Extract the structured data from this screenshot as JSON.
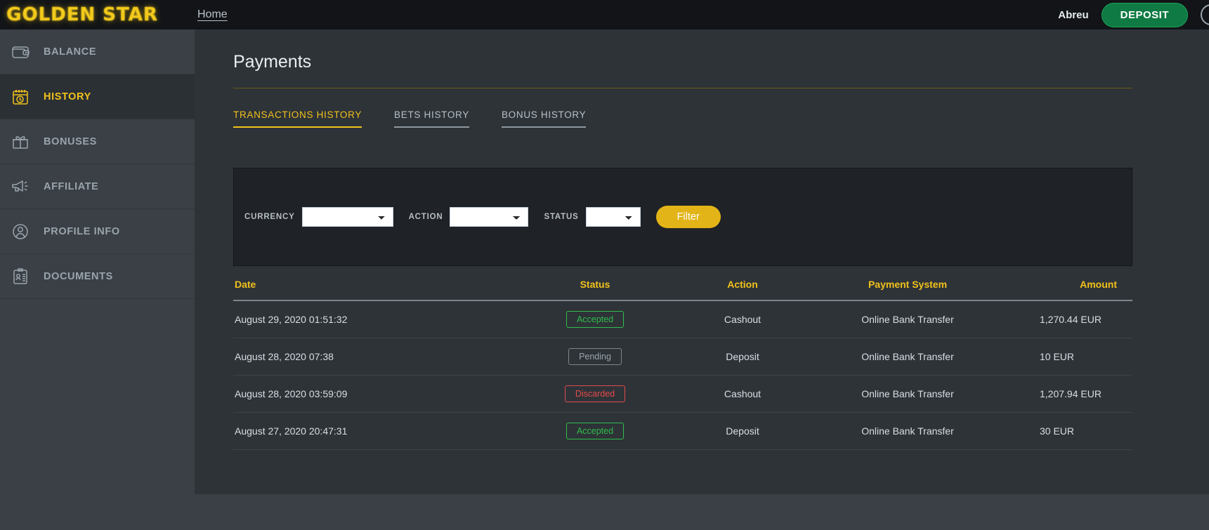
{
  "header": {
    "logo_text": "GOLDEN STAR",
    "nav": [
      {
        "label": "Home"
      }
    ],
    "username": "Abreu",
    "deposit_label": "DEPOSIT",
    "avatar_icon": "user-avatar-icon",
    "accent_yellow": "#f2c21b",
    "deposit_green": "#0f7a43"
  },
  "sidebar": {
    "items": [
      {
        "label": "BALANCE",
        "icon": "wallet-icon",
        "active": false
      },
      {
        "label": "HISTORY",
        "icon": "calendar-clock-icon",
        "active": true
      },
      {
        "label": "BONUSES",
        "icon": "gift-icon",
        "active": false
      },
      {
        "label": "AFFILIATE",
        "icon": "megaphone-icon",
        "active": false
      },
      {
        "label": "PROFILE INFO",
        "icon": "person-icon",
        "active": false
      },
      {
        "label": "DOCUMENTS",
        "icon": "id-card-icon",
        "active": false
      }
    ]
  },
  "main": {
    "page_title": "Payments",
    "tabs": [
      {
        "label": "TRANSACTIONS HISTORY",
        "active": true
      },
      {
        "label": "BETS HISTORY",
        "active": false
      },
      {
        "label": "BONUS HISTORY",
        "active": false
      }
    ],
    "filter": {
      "currency_label": "CURRENCY",
      "currency_value": "",
      "action_label": "ACTION",
      "action_value": "",
      "status_label": "STATUS",
      "status_value": "",
      "filter_button": "Filter",
      "dropdown_icon": "chevron-down-icon"
    },
    "table": {
      "columns": [
        {
          "key": "date",
          "label": "Date"
        },
        {
          "key": "status",
          "label": "Status"
        },
        {
          "key": "action",
          "label": "Action"
        },
        {
          "key": "system",
          "label": "Payment System"
        },
        {
          "key": "amount",
          "label": "Amount"
        }
      ],
      "rows": [
        {
          "date": "August 29, 2020 01:51:32",
          "status": "Accepted",
          "status_kind": "accepted",
          "action": "Cashout",
          "system": "Online Bank Transfer",
          "amount": "1,270.44 EUR"
        },
        {
          "date": "August 28, 2020 07:38",
          "status": "Pending",
          "status_kind": "pending",
          "action": "Deposit",
          "system": "Online Bank Transfer",
          "amount": "10 EUR"
        },
        {
          "date": "August 28, 2020 03:59:09",
          "status": "Discarded",
          "status_kind": "discarded",
          "action": "Cashout",
          "system": "Online Bank Transfer",
          "amount": "1,207.94 EUR"
        },
        {
          "date": "August 27, 2020 20:47:31",
          "status": "Accepted",
          "status_kind": "accepted",
          "action": "Deposit",
          "system": "Online Bank Transfer",
          "amount": "30 EUR"
        }
      ]
    }
  }
}
